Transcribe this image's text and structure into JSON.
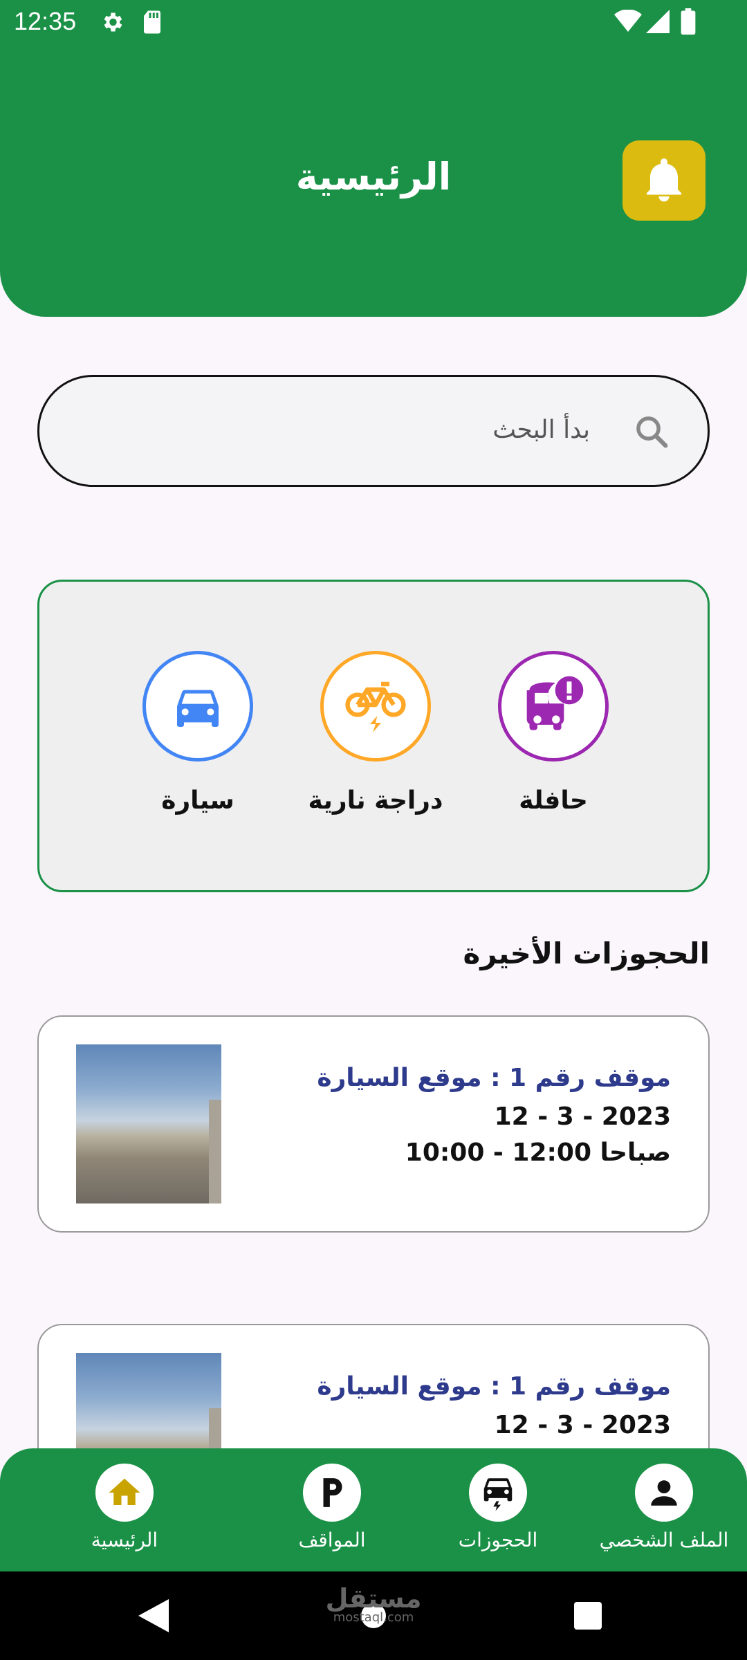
{
  "status_bar": {
    "time": "12:35"
  },
  "header": {
    "title": "الرئيسية"
  },
  "search": {
    "placeholder": "بدأ البحث"
  },
  "categories": [
    {
      "label": "حافلة",
      "icon": "bus-alert-icon",
      "color": "#9c27b0"
    },
    {
      "label": "دراجة نارية",
      "icon": "electric-bike-icon",
      "color": "#ffa726"
    },
    {
      "label": "سيارة",
      "icon": "car-icon",
      "color": "#4285f4"
    }
  ],
  "recent": {
    "title": "الحجوزات الأخيرة",
    "items": [
      {
        "title": "موقف رقم 1 : موقع السيارة",
        "date": "2023 - 3 - 12",
        "time": "صباحا 12:00 - 10:00"
      },
      {
        "title": "موقف رقم 1 : موقع السيارة",
        "date": "2023 - 3 - 12",
        "time": ""
      }
    ]
  },
  "nav": [
    {
      "label": "الملف الشخصي",
      "icon": "person-icon"
    },
    {
      "label": "الحجوزات",
      "icon": "car-charge-icon"
    },
    {
      "label": "المواقف",
      "icon": "parking-icon"
    },
    {
      "label": "الرئيسية",
      "icon": "home-icon"
    }
  ],
  "colors": {
    "primary": "#1a9147",
    "bell": "#dbbb10",
    "booking_title": "#2e3a8c",
    "home_icon": "#c9a400"
  },
  "watermark": {
    "main": "مستقل",
    "sub": "mostaql.com"
  }
}
